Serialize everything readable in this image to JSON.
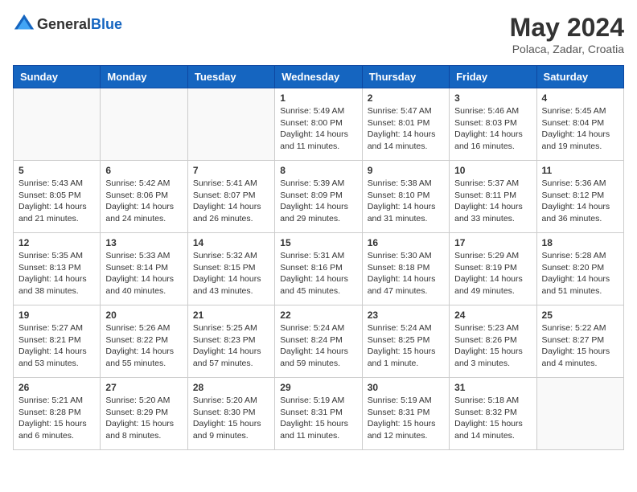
{
  "header": {
    "logo_general": "General",
    "logo_blue": "Blue",
    "title": "May 2024",
    "location": "Polaca, Zadar, Croatia"
  },
  "weekdays": [
    "Sunday",
    "Monday",
    "Tuesday",
    "Wednesday",
    "Thursday",
    "Friday",
    "Saturday"
  ],
  "days": [
    {
      "num": "",
      "empty": true
    },
    {
      "num": "",
      "empty": true
    },
    {
      "num": "",
      "empty": true
    },
    {
      "num": "1",
      "sunrise": "5:49 AM",
      "sunset": "8:00 PM",
      "daylight": "14 hours and 11 minutes."
    },
    {
      "num": "2",
      "sunrise": "5:47 AM",
      "sunset": "8:01 PM",
      "daylight": "14 hours and 14 minutes."
    },
    {
      "num": "3",
      "sunrise": "5:46 AM",
      "sunset": "8:03 PM",
      "daylight": "14 hours and 16 minutes."
    },
    {
      "num": "4",
      "sunrise": "5:45 AM",
      "sunset": "8:04 PM",
      "daylight": "14 hours and 19 minutes."
    },
    {
      "num": "5",
      "sunrise": "5:43 AM",
      "sunset": "8:05 PM",
      "daylight": "14 hours and 21 minutes."
    },
    {
      "num": "6",
      "sunrise": "5:42 AM",
      "sunset": "8:06 PM",
      "daylight": "14 hours and 24 minutes."
    },
    {
      "num": "7",
      "sunrise": "5:41 AM",
      "sunset": "8:07 PM",
      "daylight": "14 hours and 26 minutes."
    },
    {
      "num": "8",
      "sunrise": "5:39 AM",
      "sunset": "8:09 PM",
      "daylight": "14 hours and 29 minutes."
    },
    {
      "num": "9",
      "sunrise": "5:38 AM",
      "sunset": "8:10 PM",
      "daylight": "14 hours and 31 minutes."
    },
    {
      "num": "10",
      "sunrise": "5:37 AM",
      "sunset": "8:11 PM",
      "daylight": "14 hours and 33 minutes."
    },
    {
      "num": "11",
      "sunrise": "5:36 AM",
      "sunset": "8:12 PM",
      "daylight": "14 hours and 36 minutes."
    },
    {
      "num": "12",
      "sunrise": "5:35 AM",
      "sunset": "8:13 PM",
      "daylight": "14 hours and 38 minutes."
    },
    {
      "num": "13",
      "sunrise": "5:33 AM",
      "sunset": "8:14 PM",
      "daylight": "14 hours and 40 minutes."
    },
    {
      "num": "14",
      "sunrise": "5:32 AM",
      "sunset": "8:15 PM",
      "daylight": "14 hours and 43 minutes."
    },
    {
      "num": "15",
      "sunrise": "5:31 AM",
      "sunset": "8:16 PM",
      "daylight": "14 hours and 45 minutes."
    },
    {
      "num": "16",
      "sunrise": "5:30 AM",
      "sunset": "8:18 PM",
      "daylight": "14 hours and 47 minutes."
    },
    {
      "num": "17",
      "sunrise": "5:29 AM",
      "sunset": "8:19 PM",
      "daylight": "14 hours and 49 minutes."
    },
    {
      "num": "18",
      "sunrise": "5:28 AM",
      "sunset": "8:20 PM",
      "daylight": "14 hours and 51 minutes."
    },
    {
      "num": "19",
      "sunrise": "5:27 AM",
      "sunset": "8:21 PM",
      "daylight": "14 hours and 53 minutes."
    },
    {
      "num": "20",
      "sunrise": "5:26 AM",
      "sunset": "8:22 PM",
      "daylight": "14 hours and 55 minutes."
    },
    {
      "num": "21",
      "sunrise": "5:25 AM",
      "sunset": "8:23 PM",
      "daylight": "14 hours and 57 minutes."
    },
    {
      "num": "22",
      "sunrise": "5:24 AM",
      "sunset": "8:24 PM",
      "daylight": "14 hours and 59 minutes."
    },
    {
      "num": "23",
      "sunrise": "5:24 AM",
      "sunset": "8:25 PM",
      "daylight": "15 hours and 1 minute."
    },
    {
      "num": "24",
      "sunrise": "5:23 AM",
      "sunset": "8:26 PM",
      "daylight": "15 hours and 3 minutes."
    },
    {
      "num": "25",
      "sunrise": "5:22 AM",
      "sunset": "8:27 PM",
      "daylight": "15 hours and 4 minutes."
    },
    {
      "num": "26",
      "sunrise": "5:21 AM",
      "sunset": "8:28 PM",
      "daylight": "15 hours and 6 minutes."
    },
    {
      "num": "27",
      "sunrise": "5:20 AM",
      "sunset": "8:29 PM",
      "daylight": "15 hours and 8 minutes."
    },
    {
      "num": "28",
      "sunrise": "5:20 AM",
      "sunset": "8:30 PM",
      "daylight": "15 hours and 9 minutes."
    },
    {
      "num": "29",
      "sunrise": "5:19 AM",
      "sunset": "8:31 PM",
      "daylight": "15 hours and 11 minutes."
    },
    {
      "num": "30",
      "sunrise": "5:19 AM",
      "sunset": "8:31 PM",
      "daylight": "15 hours and 12 minutes."
    },
    {
      "num": "31",
      "sunrise": "5:18 AM",
      "sunset": "8:32 PM",
      "daylight": "15 hours and 14 minutes."
    },
    {
      "num": "",
      "empty": true
    }
  ],
  "labels": {
    "sunrise": "Sunrise:",
    "sunset": "Sunset:",
    "daylight": "Daylight:"
  }
}
